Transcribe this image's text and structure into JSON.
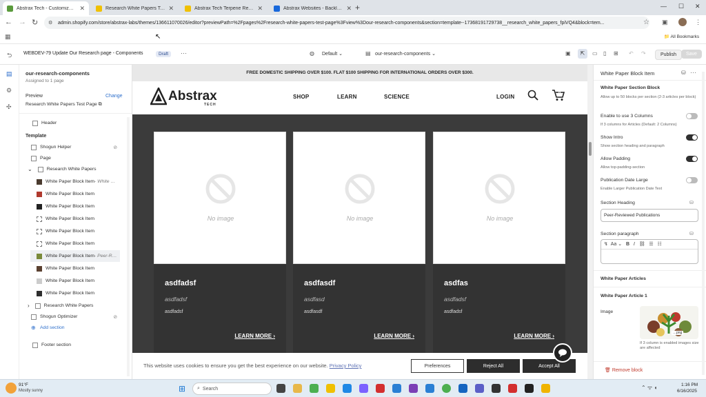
{
  "browser": {
    "tabs": [
      {
        "title": "Abstrax Tech - Customize WEB…",
        "active": true,
        "color": "#5a9a3c"
      },
      {
        "title": "Research White Papers Test Pag…",
        "active": false,
        "color": "#f0c000"
      },
      {
        "title": "Abstrax Tech Terpene Research…",
        "active": false,
        "color": "#f0c000"
      },
      {
        "title": "Abstrax Websites - Backlog - Ji…",
        "active": false,
        "color": "#1868db"
      }
    ],
    "url": "admin.shopify.com/store/abstrax-labs/themes/136611070026/editor?previewPath=%2Fpages%2Fresearch-white-papers-test-page%3Fview%3Dour-research-components&section=template--17368191729738__research_white_papers_fpiVQ4&block=tem...",
    "bookmarks_label": "All Bookmarks"
  },
  "editor": {
    "title": "WEBDEV-79 Update Our Research page - Components",
    "status": "Draft",
    "device_label": "Default",
    "template_label": "our-research-components",
    "publish_label": "Publish",
    "save_label": "Save"
  },
  "left_panel": {
    "template_name": "our-research-components",
    "assigned": "Assigned to 1 page",
    "preview_label": "Preview",
    "change_label": "Change",
    "preview_page": "Research White Papers Test Page",
    "header_item": "Header",
    "template_heading": "Template",
    "items": [
      {
        "label": "Shogun Helper",
        "indent": 0,
        "sel": false
      },
      {
        "label": "Page",
        "indent": 0,
        "sel": false
      },
      {
        "label": "Research White Papers",
        "indent": 1,
        "sel": false
      },
      {
        "label": "White Paper Block Item",
        "sub": " - White …",
        "indent": 2,
        "sel": false
      },
      {
        "label": "White Paper Block Item",
        "sub": "",
        "indent": 2,
        "sel": false
      },
      {
        "label": "White Paper Block Item",
        "sub": "",
        "indent": 2,
        "sel": false
      },
      {
        "label": "White Paper Block Item",
        "sub": "",
        "indent": 2,
        "sel": false
      },
      {
        "label": "White Paper Block Item",
        "sub": "",
        "indent": 2,
        "sel": false
      },
      {
        "label": "White Paper Block Item",
        "sub": "",
        "indent": 2,
        "sel": false
      },
      {
        "label": "White Paper Block Item",
        "sub": " - Peer-R…",
        "indent": 2,
        "sel": true
      },
      {
        "label": "White Paper Block Item",
        "sub": "",
        "indent": 2,
        "sel": false
      },
      {
        "label": "White Paper Block Item",
        "sub": "",
        "indent": 2,
        "sel": false
      },
      {
        "label": "White Paper Block Item",
        "sub": "",
        "indent": 2,
        "sel": false
      },
      {
        "label": "Research White Papers",
        "indent": 1,
        "sel": false
      },
      {
        "label": "Shogun Optimizer",
        "indent": 0,
        "sel": false
      },
      {
        "label": "Add section",
        "indent": 0,
        "sel": false
      }
    ],
    "footer_item": "Footer section"
  },
  "preview": {
    "announcement": "FREE DOMESTIC SHIPPING OVER $100. FLAT $100 SHIPPING FOR INTERNATIONAL ORDERS OVER $300.",
    "logo_main": "Abstrax",
    "logo_sub": "TECH",
    "nav": [
      "SHOP",
      "LEARN",
      "SCIENCE"
    ],
    "login": "LOGIN",
    "cart_count": "0",
    "cards": [
      {
        "title": "asdfadsf",
        "subtitle": "asdfadsf",
        "text": "asdfadsf",
        "no_image": "No image",
        "read_more": "LEARN MORE"
      },
      {
        "title": "asdfasdf",
        "subtitle": "asdfasd",
        "text": "asdfasdf",
        "no_image": "No image",
        "read_more": "LEARN MORE"
      },
      {
        "title": "asdfas",
        "subtitle": "asdfadsf",
        "text": "asdfadsf",
        "no_image": "No image",
        "read_more": "LEARN MORE"
      }
    ],
    "cookie_text": "This website uses cookies to ensure you get the best experience on our website.",
    "privacy_link": "Privacy Policy",
    "preferences": "Preferences",
    "reject": "Reject All",
    "accept": "Accept All"
  },
  "right_panel": {
    "title": "White Paper Block Item",
    "section_title": "White Paper Section Block",
    "section_desc": "Allow up to 50 blocks per section (2-3 articles per block)",
    "enable3": "Enable to use 3 Columns",
    "enable3_desc": "If 3 columns for Articles (Default: 2 Columns)",
    "show_intro": "Show Intro",
    "show_intro_desc": "Show section heading and paragraph",
    "allow_padding": "Allow Padding",
    "allow_padding_desc": "Allow top-padding-section",
    "pub_date": "Publication Date Large",
    "pub_date_desc": "Enable Larger Publication Date Text",
    "section_heading": "Section Heading",
    "section_heading_value": "Peer-Reviewed Publications",
    "section_paragraph": "Section paragraph",
    "articles": "White Paper Articles",
    "article1": "White Paper Article 1",
    "image_label": "Image",
    "image_note": "If 3 column is enabled images size are affected",
    "remove_block": "Remove block",
    "toggles": {
      "enable3": false,
      "show_intro": true,
      "allow_padding": true,
      "pub_date": false
    }
  },
  "taskbar": {
    "weather": "91°F",
    "weather_desc": "Mostly sunny",
    "search": "Search",
    "time": "1:16 PM",
    "date": "6/16/2025"
  }
}
